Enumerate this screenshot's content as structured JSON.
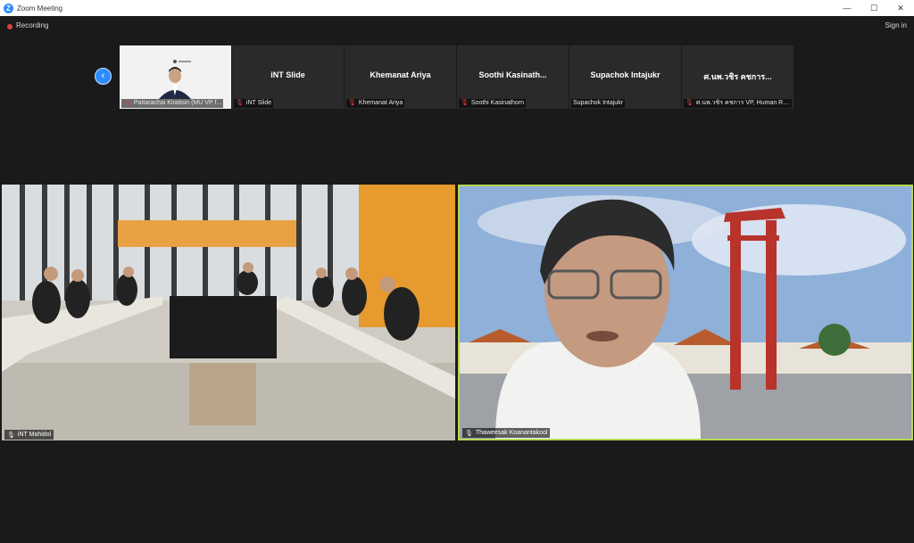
{
  "window": {
    "title": "Zoom Meeting",
    "app_icon": "Z",
    "controls": [
      "minimize-icon",
      "maximize-icon",
      "close-icon"
    ]
  },
  "topbar": {
    "recording_label": "Recording",
    "sign_in_label": "Sign in"
  },
  "gallery": {
    "nav_prev_icon": "chevron-left-icon",
    "thumbnails": [
      {
        "big_name": "",
        "caption": "Pattarachai Kiratisin (MU VP f...",
        "muted": true,
        "has_video": true
      },
      {
        "big_name": "iNT Slide",
        "caption": "iNT Slide",
        "muted": true,
        "has_video": false
      },
      {
        "big_name": "Khemanat Ariya",
        "caption": "Khemanat Ariya",
        "muted": true,
        "has_video": false
      },
      {
        "big_name": "Soothi  Kasinath...",
        "caption": "Soothi Kasinathorn",
        "muted": true,
        "has_video": false
      },
      {
        "big_name": "Supachok Intajukr",
        "caption": "Supachok Intajukr",
        "muted": false,
        "has_video": false
      },
      {
        "big_name": "ศ.นพ.วชิร คชการ...",
        "caption": "ศ.นพ.วชิร คชการ VP, Human Re...",
        "muted": true,
        "has_video": false
      }
    ]
  },
  "main": {
    "left": {
      "caption": "iNT Mahidol"
    },
    "right": {
      "caption": "Thaweesak Koanantakool",
      "active_speaker_color": "#b6d954"
    }
  },
  "colors": {
    "accent": "#2d8cff",
    "background": "#1a1a1a",
    "muted_red": "#e0423b"
  }
}
